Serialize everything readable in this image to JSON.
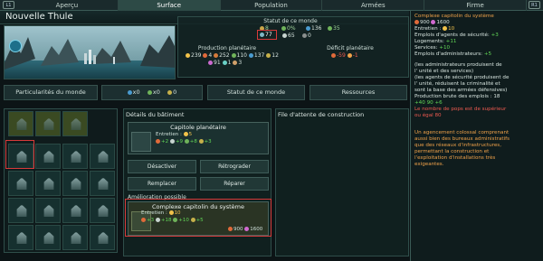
{
  "tabs": {
    "left_key": "L1",
    "right_key": "R1",
    "items": [
      "Aperçu",
      "Surface",
      "Population",
      "Armées",
      "Firme"
    ],
    "active_index": 1
  },
  "title": "Nouvelle Thule",
  "world_status": {
    "label": "Statut de ce monde",
    "row1": [
      "8",
      "0%",
      "136",
      "35"
    ],
    "pops": "77",
    "housing": "65",
    "zero": "0"
  },
  "production": {
    "label": "Production planétaire",
    "row1": [
      "239",
      "4",
      "252",
      "110",
      "137",
      "12"
    ],
    "row2": [
      "91",
      "1",
      "3"
    ]
  },
  "deficit": {
    "label": "Déficit planétaire",
    "values": [
      "-59",
      "-1"
    ]
  },
  "buttons": {
    "particularites": "Particularités du monde",
    "x0a": "x0",
    "x0b": "x0",
    "zero": "0",
    "statut": "Statut de ce monde",
    "ressources": "Ressources"
  },
  "details": {
    "title": "Détails du bâtiment",
    "current": {
      "name": "Capitole planétaire",
      "upkeep_label": "Entretien :",
      "upkeep": "5",
      "effects": [
        "+2",
        "+9",
        "+8",
        "+3"
      ]
    },
    "actions": {
      "desactiver": "Désactiver",
      "retrograder": "Rétrograder",
      "remplacer": "Remplacer",
      "reparer": "Réparer"
    },
    "upgrade_label": "Amélioration possible",
    "upgrade": {
      "name": "Complexe capitolin du système",
      "upkeep_label": "Entretien :",
      "upkeep": "10",
      "effects": [
        "+3",
        "+18",
        "+10",
        "+5"
      ],
      "cost_minerals": "900",
      "cost_rare": "1600"
    }
  },
  "queue": {
    "title": "File d'attente de construction"
  },
  "info": {
    "title": "Complexe capitolin du système",
    "cost_a": "900",
    "cost_b": "1600",
    "lines": [
      {
        "text": "Entretien : ",
        "val": "10",
        "cls": "gold"
      },
      {
        "text": "Emplois d'agents de sécurité: ",
        "val": "+3",
        "cls": "green"
      },
      {
        "text": "Logements: ",
        "val": "+11",
        "cls": "green"
      },
      {
        "text": "Services: ",
        "val": "+10",
        "cls": "green"
      },
      {
        "text": "Emplois d'administrateurs: ",
        "val": "+5",
        "cls": "green"
      }
    ],
    "para1": [
      "(les  administrateurs produisent de",
      "l' unité et des  services)",
      "(les  agents de sécurité produisent de",
      "l' unité, réduisent la  criminalité et",
      "sont la base des  armées défensives)",
      "Production brute des emplois : 18",
      "+40  90  +6"
    ],
    "warn": [
      " Le nombre de pops est de supérieur",
      "ou égal 80"
    ],
    "para2": [
      "Un agencement colossal comprenant",
      "aussi bien des bureaux administratifs",
      "que des réseaux d'infrastructures,",
      "permettant la construction et",
      "l'exploitation d'installations très",
      "exigeantes."
    ]
  },
  "colors": {
    "accent": "#3a5a55",
    "highlight_red": "#d83a3a",
    "positive": "#62d657",
    "negative": "#ef5a50",
    "gold": "#f2c24a"
  }
}
